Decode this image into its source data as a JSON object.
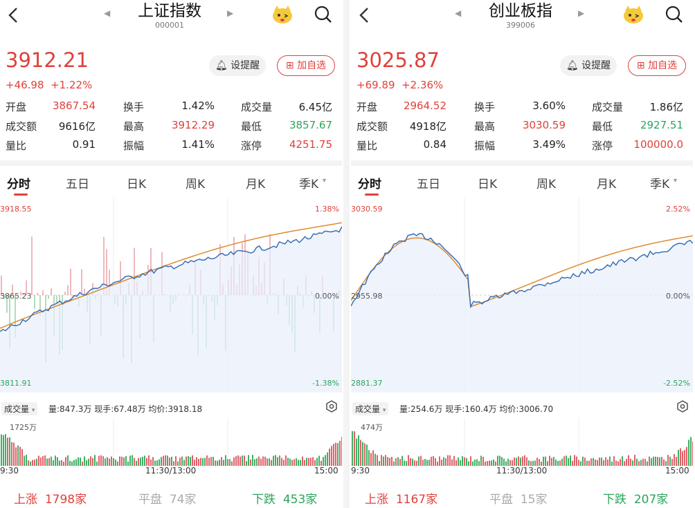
{
  "panels": [
    {
      "header": {
        "title": "上证指数",
        "code": "000001"
      },
      "quote": {
        "price": "3912.21",
        "change": "+46.98",
        "change_pct": "+1.22%"
      },
      "buttons": {
        "remind": "设提醒",
        "add_fav": "加自选"
      },
      "stats": [
        {
          "label": "开盘",
          "value": "3867.54",
          "color": "#e0403a"
        },
        {
          "label": "换手",
          "value": "1.42%",
          "color": "#222222"
        },
        {
          "label": "成交量",
          "value": "6.45亿",
          "color": "#222222"
        },
        {
          "label": "成交额",
          "value": "9616亿",
          "color": "#222222"
        },
        {
          "label": "最高",
          "value": "3912.29",
          "color": "#e0403a"
        },
        {
          "label": "最低",
          "value": "3857.67",
          "color": "#2aa55a"
        },
        {
          "label": "量比",
          "value": "0.91",
          "color": "#222222"
        },
        {
          "label": "振幅",
          "value": "1.41%",
          "color": "#222222"
        },
        {
          "label": "涨停",
          "value": "4251.75",
          "color": "#e0403a"
        }
      ],
      "tabs": [
        "分时",
        "五日",
        "日K",
        "周K",
        "月K",
        "季K"
      ],
      "chart": {
        "y_high": "3918.55",
        "y_mid": "3865.23",
        "y_low": "3811.91",
        "pct_high": "1.38%",
        "pct_mid": "0.00%",
        "pct_low": "-1.38%"
      },
      "volume": {
        "selector": "成交量",
        "info": "量:847.3万 现手:67.48万 均价:3918.18",
        "max_label": "1725万"
      },
      "time_axis": {
        "start": "9:30",
        "mid": "11:30/13:00",
        "end": "15:00"
      },
      "breadth": {
        "up_label": "上涨",
        "up_count": "1798家",
        "flat_label": "平盘",
        "flat_count": "74家",
        "down_label": "下跌",
        "down_count": "453家"
      }
    },
    {
      "header": {
        "title": "创业板指",
        "code": "399006"
      },
      "quote": {
        "price": "3025.87",
        "change": "+69.89",
        "change_pct": "+2.36%"
      },
      "buttons": {
        "remind": "设提醒",
        "add_fav": "加自选"
      },
      "stats": [
        {
          "label": "开盘",
          "value": "2964.52",
          "color": "#e0403a"
        },
        {
          "label": "换手",
          "value": "3.60%",
          "color": "#222222"
        },
        {
          "label": "成交量",
          "value": "1.86亿",
          "color": "#222222"
        },
        {
          "label": "成交额",
          "value": "4918亿",
          "color": "#222222"
        },
        {
          "label": "最高",
          "value": "3030.59",
          "color": "#e0403a"
        },
        {
          "label": "最低",
          "value": "2927.51",
          "color": "#2aa55a"
        },
        {
          "label": "量比",
          "value": "0.84",
          "color": "#222222"
        },
        {
          "label": "振幅",
          "value": "3.49%",
          "color": "#222222"
        },
        {
          "label": "涨停",
          "value": "100000.0",
          "color": "#e0403a"
        }
      ],
      "tabs": [
        "分时",
        "五日",
        "日K",
        "周K",
        "月K",
        "季K"
      ],
      "chart": {
        "y_high": "3030.59",
        "y_mid": "2955.98",
        "y_low": "2881.37",
        "pct_high": "2.52%",
        "pct_mid": "0.00%",
        "pct_low": "-2.52%"
      },
      "volume": {
        "selector": "成交量",
        "info": "量:254.6万 现手:160.4万 均价:3006.70",
        "max_label": "474万"
      },
      "time_axis": {
        "start": "9:30",
        "mid": "11:30/13:00",
        "end": "15:00"
      },
      "breadth": {
        "up_label": "上涨",
        "up_count": "1167家",
        "flat_label": "平盘",
        "flat_count": "15家",
        "down_label": "下跌",
        "down_count": "207家"
      }
    }
  ],
  "colors": {
    "up": "#e0403a",
    "down": "#2aa55a",
    "price_line": "#3b6fb5",
    "avg_line": "#e08a2e",
    "fill": "#e8f0fb",
    "flat": "#aaaaaa"
  },
  "icons": [
    "chevron-left-icon",
    "triangle-left-icon",
    "triangle-right-icon",
    "mascot-icon",
    "search-icon",
    "bell-icon",
    "plus-square-icon",
    "chevron-down-icon",
    "settings-icon"
  ]
}
